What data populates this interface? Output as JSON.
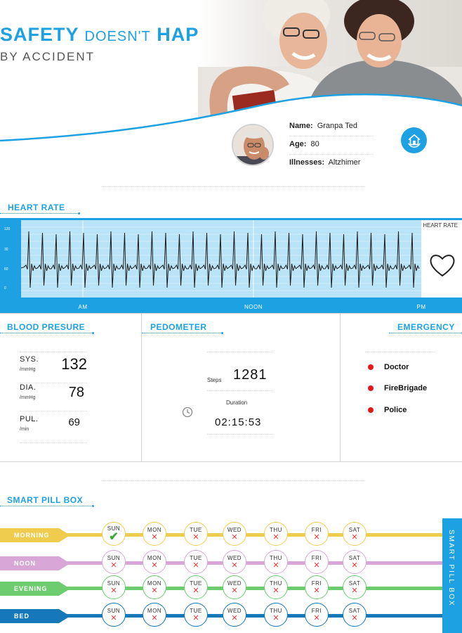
{
  "hero": {
    "title_word1": "SAFETY",
    "title_word2": "DOESN'T",
    "title_word3": "HAPPEN",
    "subtitle": "BY ACCIDENT"
  },
  "profile": {
    "name_label": "Name:",
    "name_value": "Granpa Ted",
    "age_label": "Age:",
    "age_value": "80",
    "illness_label": "Illnesses:",
    "illness_value": "Altzhimer",
    "home_icon": "home-shield-icon"
  },
  "heart_rate": {
    "title": "HEART RATE",
    "side_label": "HEART RATE",
    "time_labels": [
      "AM",
      "NOON",
      "PM"
    ],
    "y_labels": [
      "120",
      "30",
      "60",
      "0"
    ],
    "colors": {
      "panel": "#1da1e2",
      "chart_bg": "#b9e4f7",
      "trace": "#1a1a1a"
    }
  },
  "blood_pressure": {
    "title": "BLOOD PRESURE",
    "rows": [
      {
        "label": "SYS.",
        "unit": "/mmHg",
        "value": "132"
      },
      {
        "label": "DIA.",
        "unit": "/mmHg",
        "value": "78"
      },
      {
        "label": "PUL.",
        "unit": "/min",
        "value": "69"
      }
    ]
  },
  "pedometer": {
    "title": "PEDOMETER",
    "steps_label": "Steps",
    "steps_value": "1281",
    "duration_label": "Duration",
    "duration_value": "02:15:53"
  },
  "emergency": {
    "title": "EMERGENCY",
    "contacts": [
      "Doctor",
      "FireBrigade",
      "Police"
    ]
  },
  "pill_box": {
    "title": "SMART PILL BOX",
    "side_label": "SMART PILL BOX",
    "days": [
      "SUN",
      "MON",
      "TUE",
      "WED",
      "THU",
      "FRI",
      "SAT"
    ],
    "rows": [
      {
        "name": "MORNING",
        "color": "#f0cc4e",
        "taken": [
          true,
          false,
          false,
          false,
          false,
          false,
          false
        ]
      },
      {
        "name": "NOON",
        "color": "#d8a7d8",
        "taken": [
          false,
          false,
          false,
          false,
          false,
          false,
          false
        ]
      },
      {
        "name": "EVENING",
        "color": "#6dcc6d",
        "taken": [
          false,
          false,
          false,
          false,
          false,
          false,
          false
        ]
      },
      {
        "name": "BED",
        "color": "#1677b9",
        "taken": [
          false,
          false,
          false,
          false,
          false,
          false,
          false
        ]
      }
    ]
  }
}
